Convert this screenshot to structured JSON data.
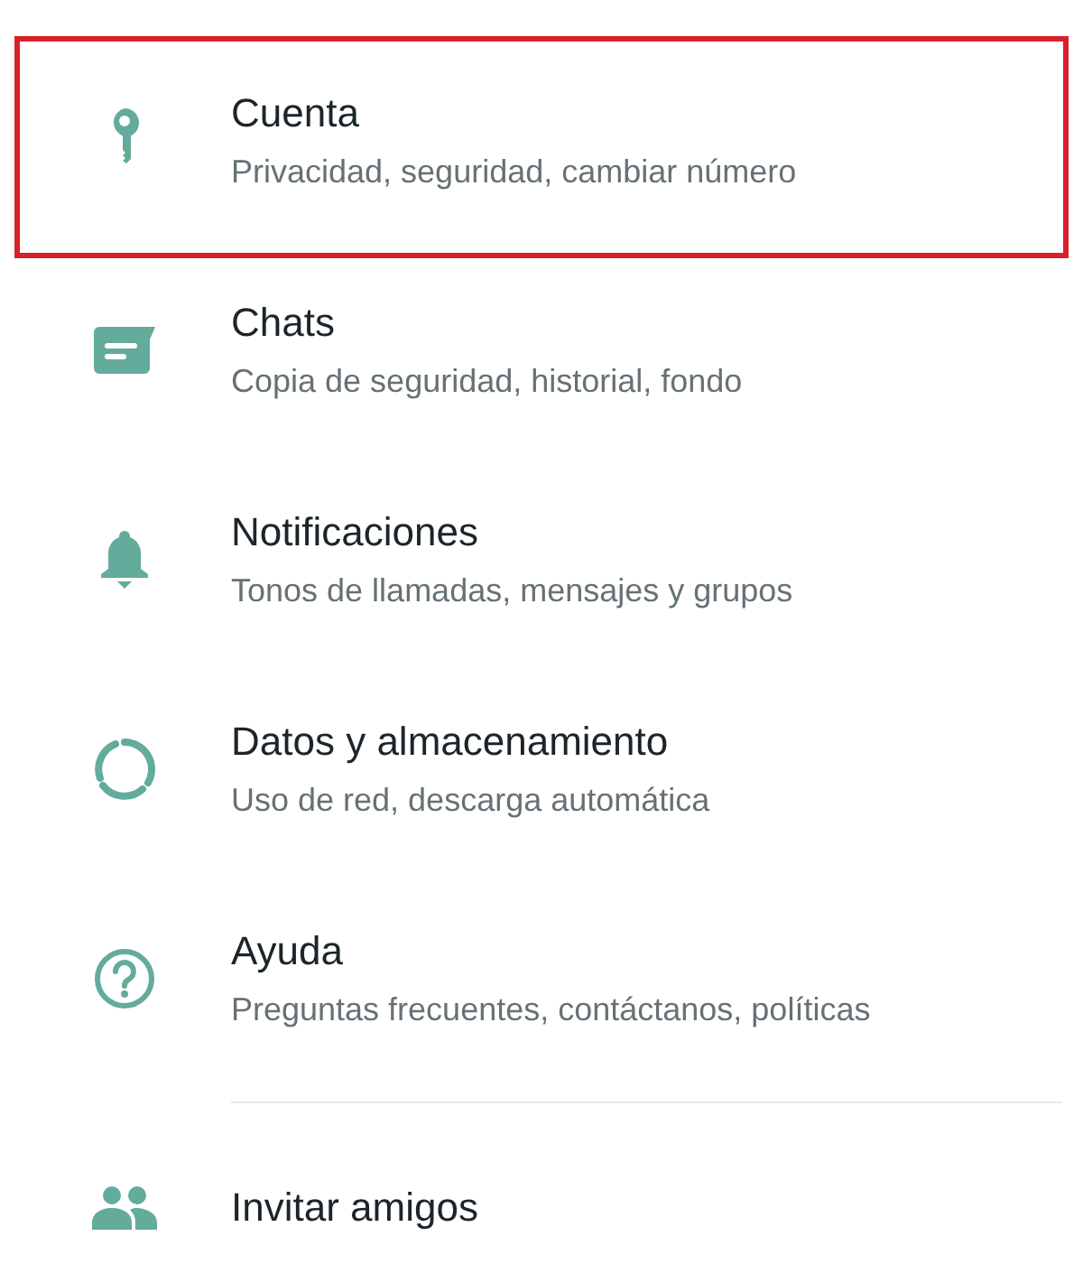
{
  "settings": [
    {
      "title": "Cuenta",
      "subtitle": "Privacidad, seguridad, cambiar número",
      "highlighted": true,
      "divider_before": false
    },
    {
      "title": "Chats",
      "subtitle": "Copia de seguridad, historial, fondo",
      "highlighted": false,
      "divider_before": false
    },
    {
      "title": "Notificaciones",
      "subtitle": "Tonos de llamadas, mensajes y grupos",
      "highlighted": false,
      "divider_before": false
    },
    {
      "title": "Datos y almacenamiento",
      "subtitle": "Uso de red, descarga automática",
      "highlighted": false,
      "divider_before": false
    },
    {
      "title": "Ayuda",
      "subtitle": "Preguntas frecuentes, contáctanos, políticas",
      "highlighted": false,
      "divider_before": false
    },
    {
      "title": "Invitar amigos",
      "highlighted": false,
      "divider_before": true
    }
  ]
}
